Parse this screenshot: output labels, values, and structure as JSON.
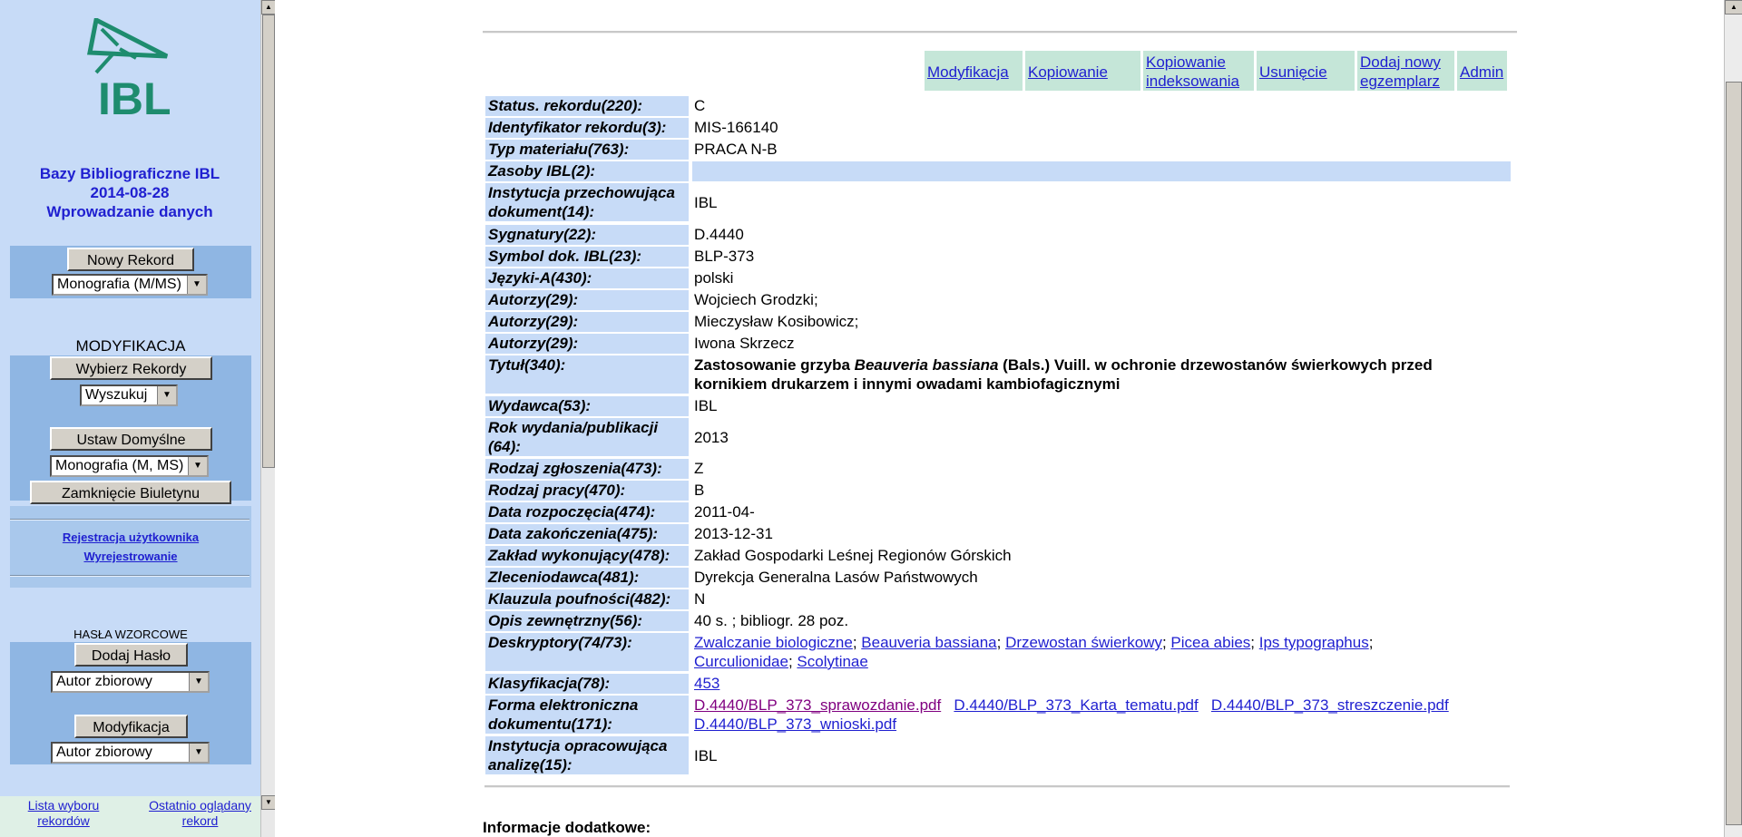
{
  "sidebar": {
    "logo_text": "IBL",
    "app_title_line1": "Bazy Bibliograficzne IBL",
    "app_title_line2": "2014-08-28",
    "app_title_line3": "Wprowadzanie danych",
    "new_record_button": "Nowy Rekord",
    "new_record_select": "Monografia (M/MS)",
    "modification_heading": "MODYFIKACJA",
    "select_records_button": "Wybierz Rekordy",
    "search_select": "Wyszukuj",
    "set_defaults_button": "Ustaw Domyślne",
    "defaults_select": "Monografia (M, MS)",
    "close_bulletin_button": "Zamknięcie Biuletynu",
    "register_link": "Rejestracja użytkownika",
    "logout_link": "Wyrejestrowanie",
    "authority_heading": "HASŁA WZORCOWE",
    "add_heading_button": "Dodaj Hasło",
    "add_heading_select": "Autor zbiorowy",
    "modify_heading_button": "Modyfikacja",
    "modify_heading_select": "Autor zbiorowy",
    "selection_list_link_1": "Lista wyboru",
    "selection_list_link_2": "rekordów",
    "last_viewed_link_1": "Ostatnio oglądany",
    "last_viewed_link_2": "rekord"
  },
  "actions": {
    "modify": "Modyfikacja",
    "copy": "Kopiowanie",
    "copy_indexing_1": "Kopiowanie",
    "copy_indexing_2": "indeksowania",
    "delete": "Usunięcie",
    "add_copy_1": "Dodaj nowy",
    "add_copy_2": "egzemplarz",
    "admin": "Admin"
  },
  "record": {
    "status_label": "Status. rekordu(220):",
    "status_value": "C",
    "id_label": "Identyfikator rekordu(3):",
    "id_value": "MIS-166140",
    "type_label": "Typ materiału(763):",
    "type_value": "PRACA N-B",
    "holdings_label": "Zasoby IBL(2):",
    "holdings_value": "",
    "institution_label_1": "Instytucja przechowująca",
    "institution_label_2": "dokument(14):",
    "institution_value": "IBL",
    "signatures_label": "Sygnatury(22):",
    "signatures_value": "D.4440",
    "symbol_label": "Symbol dok. IBL(23):",
    "symbol_value": "BLP-373",
    "languages_label": "Języki-A(430):",
    "languages_value": "polski",
    "author1_label": "Autorzy(29):",
    "author1_value": "Wojciech Grodzki;",
    "author2_label": "Autorzy(29):",
    "author2_value": "Mieczysław Kosibowicz;",
    "author3_label": "Autorzy(29):",
    "author3_value": "Iwona Skrzecz",
    "title_label": "Tytuł(340):",
    "title_part1": "Zastosowanie grzyba ",
    "title_italic": "Beauveria bassiana",
    "title_part2": " (Bals.) Vuill. w ochronie drzewostanów świerkowych przed",
    "title_line2": "kornikiem drukarzem i innymi owadami kambiofagicznymi",
    "publisher_label": "Wydawca(53):",
    "publisher_value": "IBL",
    "year_label_1": "Rok wydania/publikacji",
    "year_label_2": "(64):",
    "year_value": "2013",
    "submission_label": "Rodzaj zgłoszenia(473):",
    "submission_value": "Z",
    "work_type_label": "Rodzaj pracy(470):",
    "work_type_value": "B",
    "start_label": "Data rozpoczęcia(474):",
    "start_value": "2011-04-",
    "end_label": "Data zakończenia(475):",
    "end_value": "2013-12-31",
    "unit_label": "Zakład wykonujący(478):",
    "unit_value": "Zakład Gospodarki Leśnej Regionów Górskich",
    "client_label": "Zleceniodawca(481):",
    "client_value": "Dyrekcja Generalna Lasów Państwowych",
    "confidential_label": "Klauzula poufności(482):",
    "confidential_value": "N",
    "description_label": "Opis zewnętrzny(56):",
    "description_value": "40 s. ; bibliogr. 28 poz.",
    "descriptors_label": "Deskryptory(74/73):",
    "descriptors": [
      "Zwalczanie biologiczne",
      "Beauveria bassiana",
      "Drzewostan świerkowy",
      "Picea abies",
      "Ips typographus",
      "Curculionidae",
      "Scolytinae"
    ],
    "classification_label": "Klasyfikacja(78):",
    "classification_value": "453",
    "eform_label_1": "Forma elektroniczna",
    "eform_label_2": "dokumentu(171):",
    "files": [
      "D.4440/BLP_373_sprawozdanie.pdf",
      "D.4440/BLP_373_Karta_tematu.pdf",
      "D.4440/BLP_373_streszczenie.pdf",
      "D.4440/BLP_373_wnioski.pdf"
    ],
    "analysis_label_1": "Instytucja opracowująca",
    "analysis_label_2": "analizę(15):",
    "analysis_value": "IBL"
  },
  "footer_info": "Informacje dodatkowe:"
}
